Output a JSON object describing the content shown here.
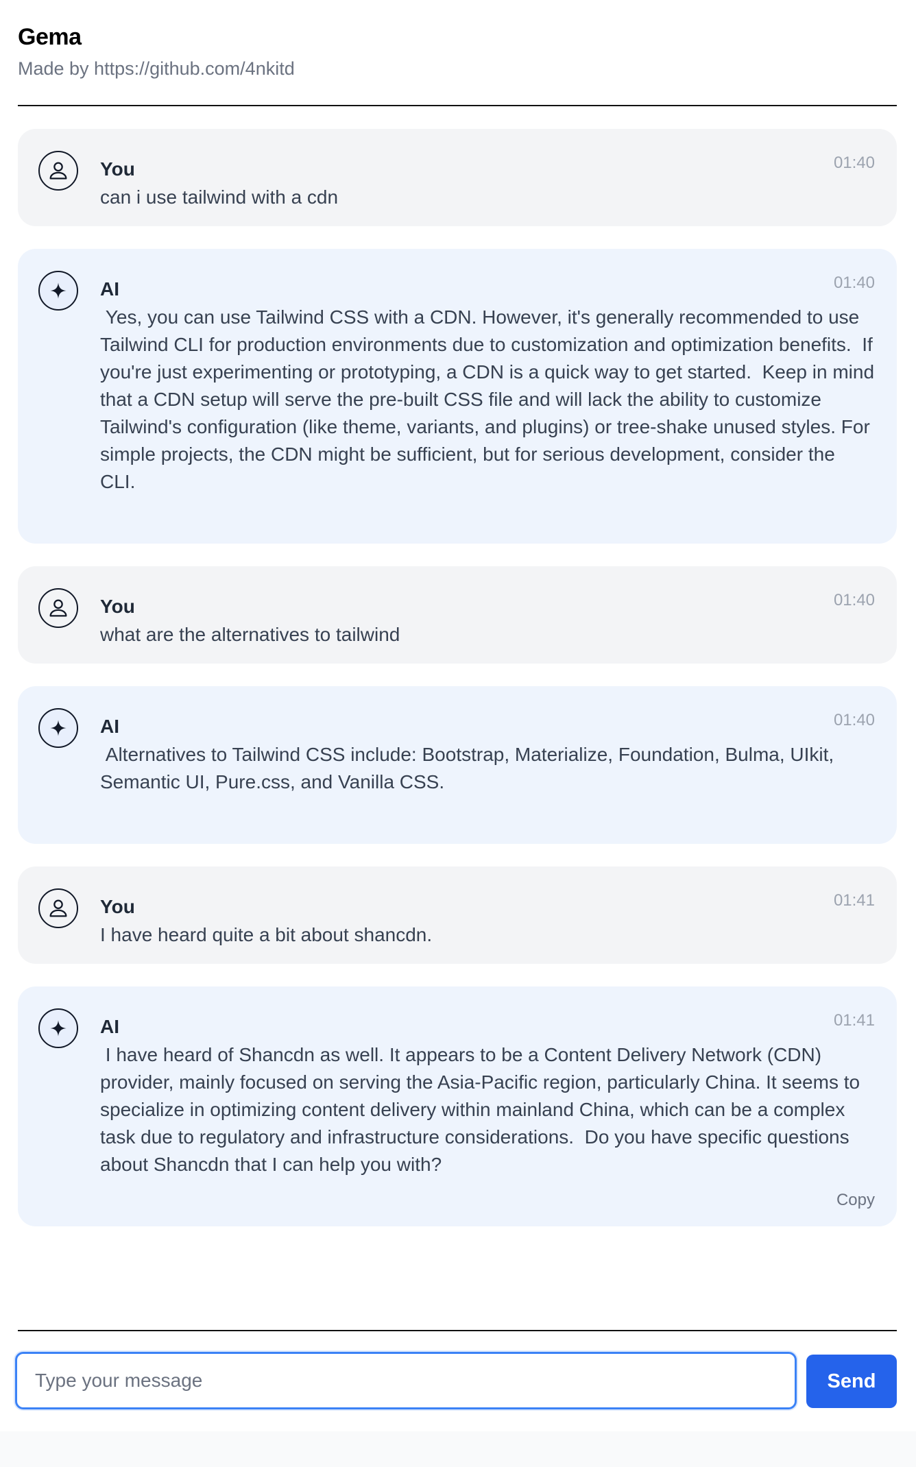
{
  "app": {
    "title": "Gema",
    "subtitle": "Made by https://github.com/4nkitd"
  },
  "messages": [
    {
      "role": "user",
      "sender": "You",
      "time": "01:40",
      "text": "can i use tailwind with a cdn"
    },
    {
      "role": "ai",
      "sender": "AI",
      "time": "01:40",
      "text": " Yes, you can use Tailwind CSS with a CDN. However, it's generally recommended to use Tailwind CLI for production environments due to customization and optimization benefits.  If you're just experimenting or prototyping, a CDN is a quick way to get started.  Keep in mind that a CDN setup will serve the pre-built CSS file and will lack the ability to customize Tailwind's configuration (like theme, variants, and plugins) or tree-shake unused styles. For simple projects, the CDN might be sufficient, but for serious development, consider the CLI.\n"
    },
    {
      "role": "user",
      "sender": "You",
      "time": "01:40",
      "text": "what are the alternatives to tailwind"
    },
    {
      "role": "ai",
      "sender": "AI",
      "time": "01:40",
      "text": " Alternatives to Tailwind CSS include: Bootstrap, Materialize, Foundation, Bulma, UIkit, Semantic UI, Pure.css, and Vanilla CSS.\n"
    },
    {
      "role": "user",
      "sender": "You",
      "time": "01:41",
      "text": "I have heard quite a bit about shancdn."
    },
    {
      "role": "ai",
      "sender": "AI",
      "time": "01:41",
      "text": " I have heard of Shancdn as well. It appears to be a Content Delivery Network (CDN) provider, mainly focused on serving the Asia-Pacific region, particularly China. It seems to specialize in optimizing content delivery within mainland China, which can be a complex task due to regulatory and infrastructure considerations.  Do you have specific questions about Shancdn that I can help you with?",
      "copy_label": "Copy"
    }
  ],
  "composer": {
    "placeholder": "Type your message",
    "value": "",
    "send_label": "Send"
  },
  "colors": {
    "accent": "#2563eb",
    "user_bubble": "#f3f4f6",
    "ai_bubble": "#eef4fd"
  }
}
